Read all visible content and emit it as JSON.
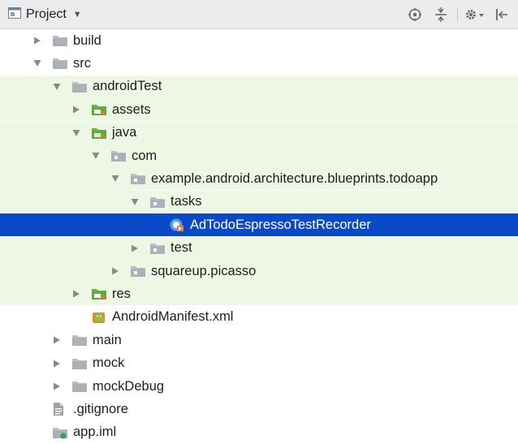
{
  "header": {
    "title": "Project",
    "icon": "project-view-icon",
    "dropdown_icon": "chevron-down-icon",
    "actions": [
      {
        "name": "locate-icon"
      },
      {
        "name": "collapse-all-icon"
      },
      {
        "name": "settings-gear-icon"
      },
      {
        "name": "hide-panel-icon"
      }
    ]
  },
  "colors": {
    "selection": "#0a49c8",
    "test_tint": "#eef6e4",
    "folder": "#b9bfc5",
    "test_folder": "#5bab3a",
    "toolbar": "#ececec"
  },
  "tree": [
    {
      "label": "build",
      "arrow": "collapsed",
      "icon": "folder-icon",
      "depth": 1
    },
    {
      "label": "src",
      "arrow": "expanded",
      "icon": "folder-icon",
      "depth": 1
    },
    {
      "label": "androidTest",
      "arrow": "expanded",
      "icon": "folder-icon",
      "depth": 2,
      "tint": true
    },
    {
      "label": "assets",
      "arrow": "collapsed",
      "icon": "test-resource-folder-icon",
      "depth": 3,
      "tint": true
    },
    {
      "label": "java",
      "arrow": "expanded",
      "icon": "test-source-folder-icon",
      "depth": 3,
      "tint": true
    },
    {
      "label": "com",
      "arrow": "expanded",
      "icon": "package-icon",
      "depth": 4,
      "tint": true
    },
    {
      "label": "example.android.architecture.blueprints.todoapp",
      "arrow": "expanded",
      "icon": "package-icon",
      "depth": 5,
      "tint": true
    },
    {
      "label": "tasks",
      "arrow": "expanded",
      "icon": "package-icon",
      "depth": 6,
      "tint": true
    },
    {
      "label": "AdTodoEspressoTestRecorder",
      "arrow": "none",
      "icon": "test-class-icon",
      "depth": 7,
      "tint": true,
      "selected": true
    },
    {
      "label": "test",
      "arrow": "collapsed",
      "icon": "package-icon",
      "depth": 6,
      "tint": true
    },
    {
      "label": "squareup.picasso",
      "arrow": "collapsed",
      "icon": "package-icon",
      "depth": 5,
      "tint": true
    },
    {
      "label": "res",
      "arrow": "collapsed",
      "icon": "test-resource-folder-icon",
      "depth": 3,
      "tint": true
    },
    {
      "label": "AndroidManifest.xml",
      "arrow": "none",
      "icon": "android-manifest-icon",
      "depth": 3
    },
    {
      "label": "main",
      "arrow": "collapsed",
      "icon": "folder-icon",
      "depth": 2
    },
    {
      "label": "mock",
      "arrow": "collapsed",
      "icon": "folder-icon",
      "depth": 2
    },
    {
      "label": "mockDebug",
      "arrow": "collapsed",
      "icon": "folder-icon",
      "depth": 2
    },
    {
      "label": ".gitignore",
      "arrow": "none",
      "icon": "text-file-icon",
      "depth": 1
    },
    {
      "label": "app.iml",
      "arrow": "none",
      "icon": "module-file-icon",
      "depth": 1
    }
  ]
}
